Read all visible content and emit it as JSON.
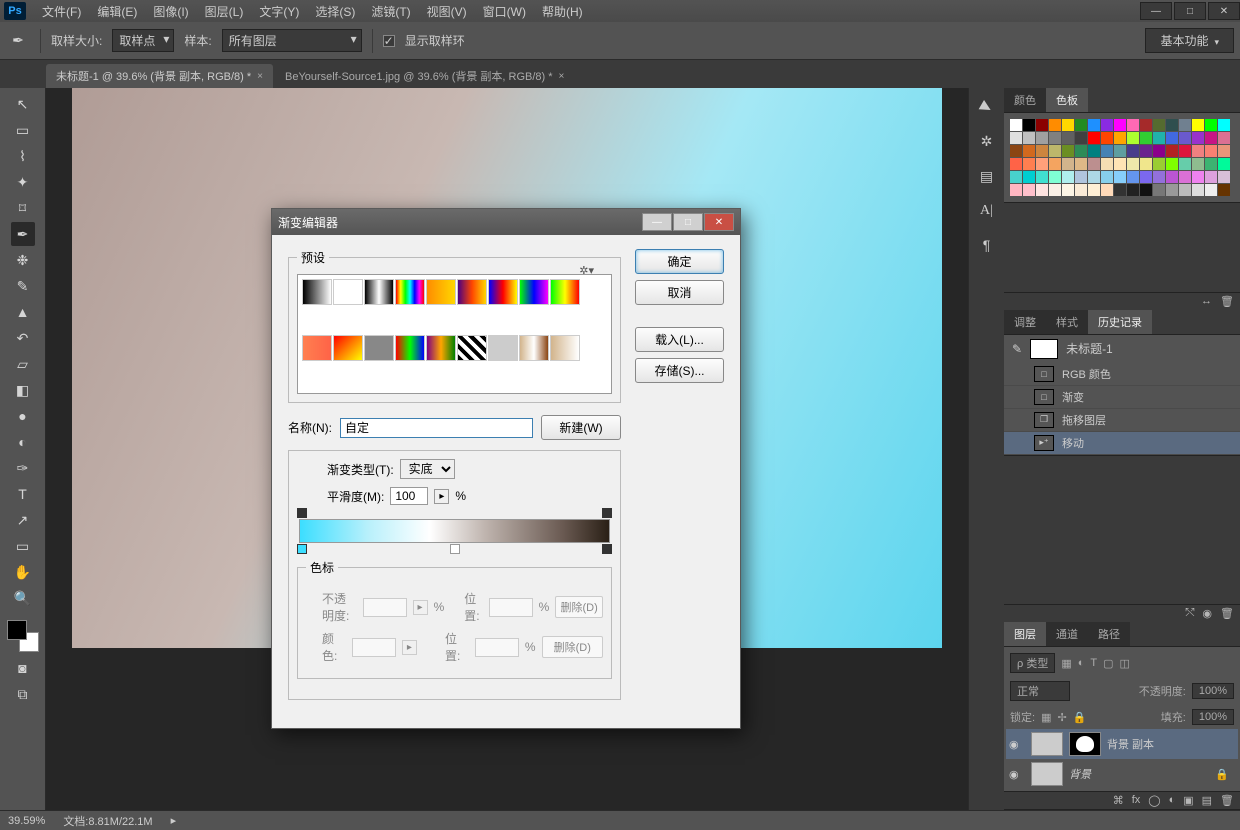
{
  "menu": [
    "文件(F)",
    "编辑(E)",
    "图像(I)",
    "图层(L)",
    "文字(Y)",
    "选择(S)",
    "滤镜(T)",
    "视图(V)",
    "窗口(W)",
    "帮助(H)"
  ],
  "options": {
    "sample_size_label": "取样大小:",
    "sample_size_value": "取样点",
    "sample_label": "样本:",
    "sample_value": "所有图层",
    "show_ring_label": "显示取样环"
  },
  "workspace": "基本功能",
  "doc_tabs": [
    {
      "title": "未标题-1 @ 39.6% (背景 副本, RGB/8) *",
      "active": true
    },
    {
      "title": "BeYourself-Source1.jpg @ 39.6% (背景 副本, RGB/8) *",
      "active": false
    }
  ],
  "panels": {
    "color_tabs": [
      "颜色",
      "色板"
    ],
    "active_color_tab": 1,
    "history_tabs": [
      "调整",
      "样式",
      "历史记录"
    ],
    "active_history_tab": 2,
    "history_title": "未标题-1",
    "history_items": [
      {
        "label": "RGB 颜色",
        "icon": "□"
      },
      {
        "label": "渐变",
        "icon": "□"
      },
      {
        "label": "拖移图层",
        "icon": "❐"
      },
      {
        "label": "移动",
        "icon": "▸⁺",
        "sel": true
      }
    ],
    "layer_tabs": [
      "图层",
      "通道",
      "路径"
    ],
    "active_layer_tab": 0,
    "layer_kind_label": "ρ 类型",
    "blend_mode": "正常",
    "opacity_label": "不透明度:",
    "opacity_value": "100%",
    "lock_label": "锁定:",
    "fill_label": "填充:",
    "fill_value": "100%",
    "layers": [
      {
        "name": "背景 副本",
        "hasMask": true,
        "sel": true,
        "vis": true
      },
      {
        "name": "背景",
        "italic": true,
        "lock": true,
        "vis": true
      }
    ]
  },
  "status": {
    "zoom": "39.59%",
    "doc_label": "文档:",
    "doc_size": "8.81M/22.1M"
  },
  "dialog": {
    "title": "渐变编辑器",
    "presets_label": "预设",
    "buttons": {
      "ok": "确定",
      "cancel": "取消",
      "load": "载入(L)...",
      "save": "存储(S)..."
    },
    "name_label": "名称(N):",
    "name_value": "自定",
    "new_btn": "新建(W)",
    "grad_type_label": "渐变类型(T):",
    "grad_type_value": "实底",
    "smooth_label": "平滑度(M):",
    "smooth_value": "100",
    "stops_label": "色标",
    "opacity_label": "不透明度:",
    "position_label": "位置:",
    "color_label": "颜色:",
    "delete_label": "删除(D)"
  },
  "swatch_colors": [
    "#ffffff",
    "#000000",
    "#8b0000",
    "#ff8c00",
    "#ffd700",
    "#228b22",
    "#1e90ff",
    "#8a2be2",
    "#ff00ff",
    "#ff69b4",
    "#a52a2a",
    "#556b2f",
    "#2f4f4f",
    "#708090",
    "#ffff00",
    "#00ff00",
    "#00ffff",
    "#e0e0e0",
    "#c0c0c0",
    "#a0a0a0",
    "#808080",
    "#606060",
    "#404040",
    "#ff0000",
    "#ff4500",
    "#ffa500",
    "#adff2f",
    "#32cd32",
    "#20b2aa",
    "#4169e1",
    "#6a5acd",
    "#9932cc",
    "#c71585",
    "#db7093",
    "#8b4513",
    "#d2691e",
    "#cd853f",
    "#bdb76b",
    "#6b8e23",
    "#2e8b57",
    "#008080",
    "#4682b4",
    "#5f9ea0",
    "#483d8b",
    "#6b238e",
    "#8b008b",
    "#b22222",
    "#dc143c",
    "#f08080",
    "#fa8072",
    "#e9967a",
    "#ff6347",
    "#ff7f50",
    "#ffa07a",
    "#f4a460",
    "#d2b48c",
    "#deb887",
    "#bc8f8f",
    "#f5deb3",
    "#ffe4b5",
    "#eee8aa",
    "#f0e68c",
    "#9acd32",
    "#7fff00",
    "#66cdaa",
    "#8fbc8f",
    "#3cb371",
    "#00fa9a",
    "#48d1cc",
    "#00ced1",
    "#40e0d0",
    "#7fffd4",
    "#afeeee",
    "#b0c4de",
    "#add8e6",
    "#87ceeb",
    "#87cefa",
    "#6495ed",
    "#7b68ee",
    "#9370db",
    "#ba55d3",
    "#da70d6",
    "#ee82ee",
    "#dda0dd",
    "#d8bfd8",
    "#ffb6c1",
    "#ffc0cb",
    "#ffe4e1",
    "#faf0e6",
    "#fdf5e6",
    "#faebd7",
    "#ffefd5",
    "#ffdab9",
    "#333333",
    "#222222",
    "#111111",
    "#777777",
    "#999999",
    "#bbbbbb",
    "#dddddd",
    "#eeeeee",
    "#663300"
  ],
  "preset_gradients": [
    "linear-gradient(90deg,#000,#fff)",
    "linear-gradient(90deg,#fff,#fff)",
    "linear-gradient(90deg,#000,#fff,#000)",
    "linear-gradient(90deg,#ff0000,#ffff00,#00ff00,#00ffff,#0000ff,#ff00ff,#ff0000)",
    "linear-gradient(90deg,#ff8c00,#ffd700)",
    "linear-gradient(90deg,#4b0082,#ff4500,#ffd700)",
    "linear-gradient(90deg,#0000ff,#ff0000,#ffff00)",
    "linear-gradient(90deg,#00ff00,#0000ff,#ff00ff)",
    "linear-gradient(90deg,#00ff00,#ffff00,#ff0000)",
    "linear-gradient(90deg,#ff7f50,#ff6347)",
    "linear-gradient(135deg,#ff0000,#ffff00)",
    "linear-gradient(90deg,#888,#888)",
    "linear-gradient(90deg,#ff0000,#00ff00,#0000ff)",
    "linear-gradient(90deg,#800080,#ffa500,#008000)",
    "repeating-linear-gradient(45deg,#000 0 4px,#fff 4px 8px)",
    "linear-gradient(90deg,#ccc,#ccc)",
    "linear-gradient(90deg,#d2b48c,#fff,#8b4513)",
    "linear-gradient(90deg,#d2b48c,#fff)"
  ]
}
